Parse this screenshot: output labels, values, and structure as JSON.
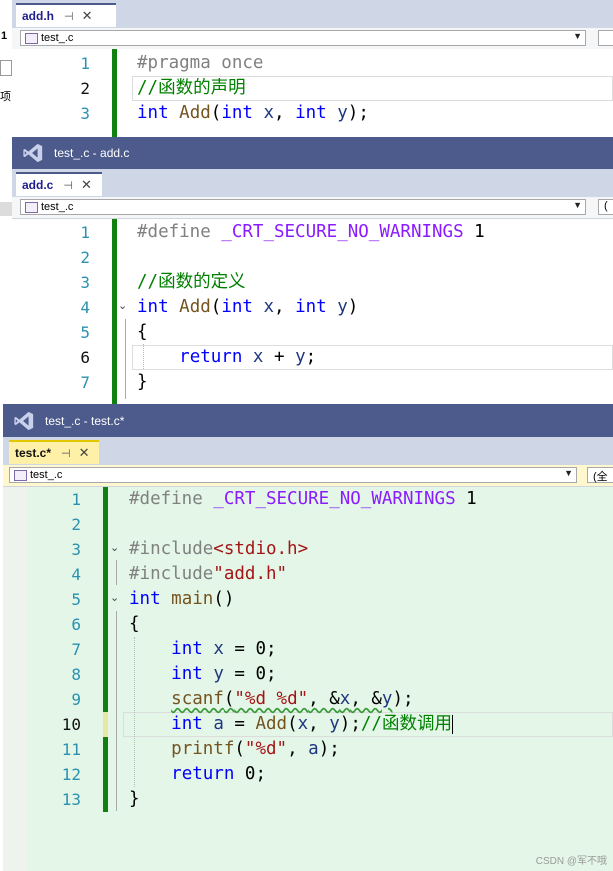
{
  "window1": {
    "tab_label": "add.h",
    "nav_file": "test_.c",
    "lines": [
      {
        "n": "1",
        "tokens": [
          {
            "c": "pp",
            "t": "#pragma once"
          }
        ]
      },
      {
        "n": "2",
        "tokens": [
          {
            "c": "cm",
            "t": "//函数的声明"
          }
        ]
      },
      {
        "n": "3",
        "tokens": [
          {
            "c": "kw",
            "t": "int"
          },
          {
            "c": "pl",
            "t": " "
          },
          {
            "c": "fn",
            "t": "Add"
          },
          {
            "c": "pl",
            "t": "("
          },
          {
            "c": "kw",
            "t": "int"
          },
          {
            "c": "pl",
            "t": " "
          },
          {
            "c": "id",
            "t": "x"
          },
          {
            "c": "pl",
            "t": ", "
          },
          {
            "c": "kw",
            "t": "int"
          },
          {
            "c": "pl",
            "t": " "
          },
          {
            "c": "id",
            "t": "y"
          },
          {
            "c": "pl",
            "t": ");"
          }
        ]
      }
    ]
  },
  "window2": {
    "title": "test_.c - add.c",
    "tab_label": "add.c",
    "nav_file": "test_.c",
    "lines": [
      {
        "n": "1",
        "tokens": [
          {
            "c": "pp",
            "t": "#define "
          },
          {
            "c": "macro",
            "t": "_CRT_SECURE_NO_WARNINGS"
          },
          {
            "c": "pl",
            "t": " 1"
          }
        ]
      },
      {
        "n": "2",
        "tokens": []
      },
      {
        "n": "3",
        "tokens": [
          {
            "c": "cm",
            "t": "//函数的定义"
          }
        ]
      },
      {
        "n": "4",
        "tokens": [
          {
            "c": "kw",
            "t": "int"
          },
          {
            "c": "pl",
            "t": " "
          },
          {
            "c": "fn",
            "t": "Add"
          },
          {
            "c": "pl",
            "t": "("
          },
          {
            "c": "kw",
            "t": "int"
          },
          {
            "c": "pl",
            "t": " "
          },
          {
            "c": "id",
            "t": "x"
          },
          {
            "c": "pl",
            "t": ", "
          },
          {
            "c": "kw",
            "t": "int"
          },
          {
            "c": "pl",
            "t": " "
          },
          {
            "c": "id",
            "t": "y"
          },
          {
            "c": "pl",
            "t": ")"
          }
        ]
      },
      {
        "n": "5",
        "tokens": [
          {
            "c": "pl",
            "t": "{"
          }
        ]
      },
      {
        "n": "6",
        "tokens": [
          {
            "c": "pl",
            "t": "    "
          },
          {
            "c": "kw",
            "t": "return"
          },
          {
            "c": "pl",
            "t": " "
          },
          {
            "c": "id",
            "t": "x"
          },
          {
            "c": "pl",
            "t": " + "
          },
          {
            "c": "id",
            "t": "y"
          },
          {
            "c": "pl",
            "t": ";"
          }
        ]
      },
      {
        "n": "7",
        "tokens": [
          {
            "c": "pl",
            "t": "}"
          }
        ]
      }
    ]
  },
  "window3": {
    "title": "test_.c - test.c*",
    "tab_label": "test.c*",
    "nav_file": "test_.c",
    "nav_right": "(全",
    "lines": [
      {
        "n": "1",
        "tokens": [
          {
            "c": "pp",
            "t": "#define "
          },
          {
            "c": "macro",
            "t": "_CRT_SECURE_NO_WARNINGS"
          },
          {
            "c": "pl",
            "t": " 1"
          }
        ]
      },
      {
        "n": "2",
        "tokens": []
      },
      {
        "n": "3",
        "tokens": [
          {
            "c": "pp",
            "t": "#include"
          },
          {
            "c": "st",
            "t": "<stdio.h>"
          }
        ]
      },
      {
        "n": "4",
        "tokens": [
          {
            "c": "pp",
            "t": "#include"
          },
          {
            "c": "st",
            "t": "\"add.h\""
          }
        ]
      },
      {
        "n": "5",
        "tokens": [
          {
            "c": "kw",
            "t": "int"
          },
          {
            "c": "pl",
            "t": " "
          },
          {
            "c": "fn",
            "t": "main"
          },
          {
            "c": "pl",
            "t": "()"
          }
        ]
      },
      {
        "n": "6",
        "tokens": [
          {
            "c": "pl",
            "t": "{"
          }
        ]
      },
      {
        "n": "7",
        "tokens": [
          {
            "c": "pl",
            "t": "    "
          },
          {
            "c": "kw",
            "t": "int"
          },
          {
            "c": "pl",
            "t": " "
          },
          {
            "c": "id",
            "t": "x"
          },
          {
            "c": "pl",
            "t": " = 0;"
          }
        ]
      },
      {
        "n": "8",
        "tokens": [
          {
            "c": "pl",
            "t": "    "
          },
          {
            "c": "kw",
            "t": "int"
          },
          {
            "c": "pl",
            "t": " "
          },
          {
            "c": "id",
            "t": "y"
          },
          {
            "c": "pl",
            "t": " = 0;"
          }
        ]
      },
      {
        "n": "9",
        "tokens": [
          {
            "c": "pl",
            "t": "    "
          },
          {
            "c": "fn squiggle",
            "t": "scanf"
          },
          {
            "c": "pl squiggle",
            "t": "("
          },
          {
            "c": "st squiggle",
            "t": "\"%d %d\""
          },
          {
            "c": "pl squiggle",
            "t": ", &"
          },
          {
            "c": "id squiggle",
            "t": "x"
          },
          {
            "c": "pl squiggle",
            "t": ", &"
          },
          {
            "c": "id squiggle",
            "t": "y"
          },
          {
            "c": "pl",
            "t": ");"
          }
        ]
      },
      {
        "n": "10",
        "tokens": [
          {
            "c": "pl",
            "t": "    "
          },
          {
            "c": "kw",
            "t": "int"
          },
          {
            "c": "pl",
            "t": " "
          },
          {
            "c": "id",
            "t": "a"
          },
          {
            "c": "pl",
            "t": " = "
          },
          {
            "c": "fn",
            "t": "Add"
          },
          {
            "c": "pl",
            "t": "("
          },
          {
            "c": "id",
            "t": "x"
          },
          {
            "c": "pl",
            "t": ", "
          },
          {
            "c": "id",
            "t": "y"
          },
          {
            "c": "pl",
            "t": ");"
          },
          {
            "c": "cm",
            "t": "//函数调用"
          }
        ]
      },
      {
        "n": "11",
        "tokens": [
          {
            "c": "pl",
            "t": "    "
          },
          {
            "c": "fn",
            "t": "printf"
          },
          {
            "c": "pl",
            "t": "("
          },
          {
            "c": "st",
            "t": "\"%d\""
          },
          {
            "c": "pl",
            "t": ", "
          },
          {
            "c": "id",
            "t": "a"
          },
          {
            "c": "pl",
            "t": ");"
          }
        ]
      },
      {
        "n": "12",
        "tokens": [
          {
            "c": "pl",
            "t": "    "
          },
          {
            "c": "kw",
            "t": "return"
          },
          {
            "c": "pl",
            "t": " 0;"
          }
        ]
      },
      {
        "n": "13",
        "tokens": [
          {
            "c": "pl",
            "t": "}"
          }
        ]
      }
    ]
  },
  "left_partial": {
    "chars": [
      "1",
      "项"
    ]
  },
  "watermark": "CSDN @军不哦"
}
